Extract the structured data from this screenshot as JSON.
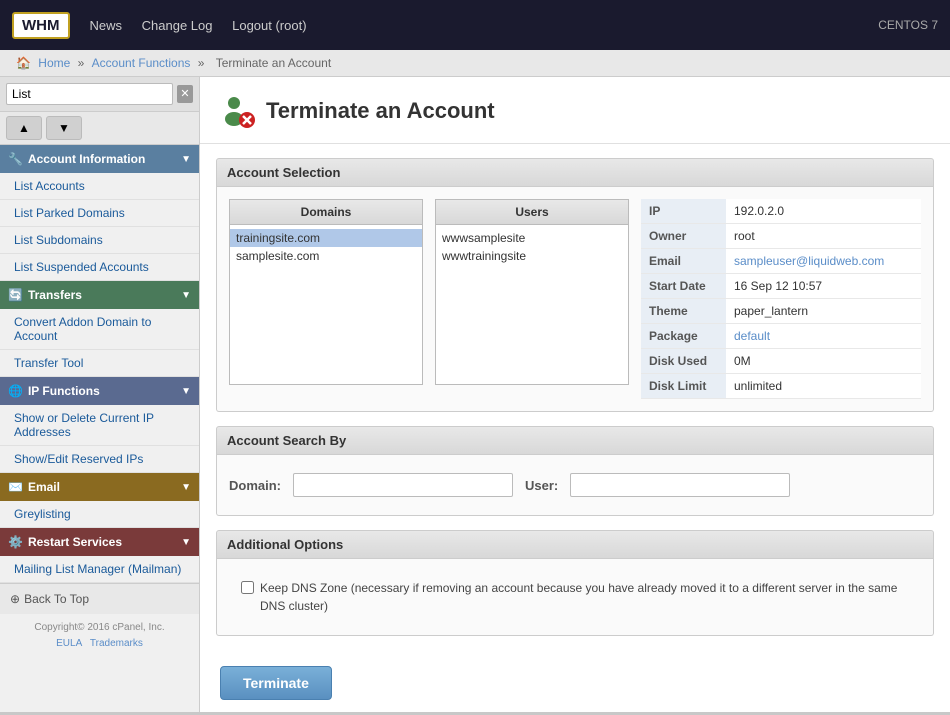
{
  "topbar": {
    "logo": "WHM",
    "os": "CENTOS 7",
    "nav": [
      {
        "label": "News",
        "href": "#"
      },
      {
        "label": "Change Log",
        "href": "#"
      },
      {
        "label": "Logout (root)",
        "href": "#"
      }
    ]
  },
  "breadcrumb": {
    "home": "Home",
    "section": "Account Functions",
    "current": "Terminate an Account"
  },
  "sidebar": {
    "search_placeholder": "List",
    "sections": [
      {
        "id": "account-information",
        "label": "Account Information",
        "items": [
          {
            "label": "List Accounts"
          },
          {
            "label": "List Parked Domains"
          },
          {
            "label": "List Subdomains"
          },
          {
            "label": "List Suspended Accounts"
          }
        ]
      },
      {
        "id": "transfers",
        "label": "Transfers",
        "items": [
          {
            "label": "Convert Addon Domain to Account"
          },
          {
            "label": "Transfer Tool"
          }
        ]
      },
      {
        "id": "ip-functions",
        "label": "IP Functions",
        "items": [
          {
            "label": "Show or Delete Current IP Addresses"
          },
          {
            "label": "Show/Edit Reserved IPs"
          }
        ]
      },
      {
        "id": "email",
        "label": "Email",
        "items": [
          {
            "label": "Greylisting"
          }
        ]
      },
      {
        "id": "restart",
        "label": "Restart Services",
        "items": [
          {
            "label": "Mailing List Manager (Mailman)"
          }
        ]
      }
    ],
    "back_to_top": "Back To Top",
    "copyright": "Copyright© 2016 cPanel, Inc.",
    "eula": "EULA",
    "trademarks": "Trademarks"
  },
  "page": {
    "title": "Terminate an Account",
    "sections": {
      "account_selection": {
        "header": "Account Selection",
        "domains_col": "Domains",
        "users_col": "Users",
        "domains": [
          "trainingsite.com",
          "samplesite.com"
        ],
        "users": [
          "wwwsamplesite",
          "wwwtrainingsite"
        ],
        "info": {
          "IP": "192.0.2.0",
          "Owner": "root",
          "Email": "sampleuser@liquidweb.com",
          "Start Date": "16 Sep 12 10:57",
          "Theme": "paper_lantern",
          "Package": "default",
          "Disk Used": "0M",
          "Disk Limit": "unlimited"
        }
      },
      "account_search": {
        "header": "Account Search By",
        "domain_label": "Domain:",
        "user_label": "User:",
        "domain_placeholder": "",
        "user_placeholder": ""
      },
      "additional_options": {
        "header": "Additional Options",
        "dns_zone_label": "Keep DNS Zone (necessary if removing an account because you have already moved it to a different server in the same DNS cluster)"
      }
    },
    "terminate_button": "Terminate"
  }
}
